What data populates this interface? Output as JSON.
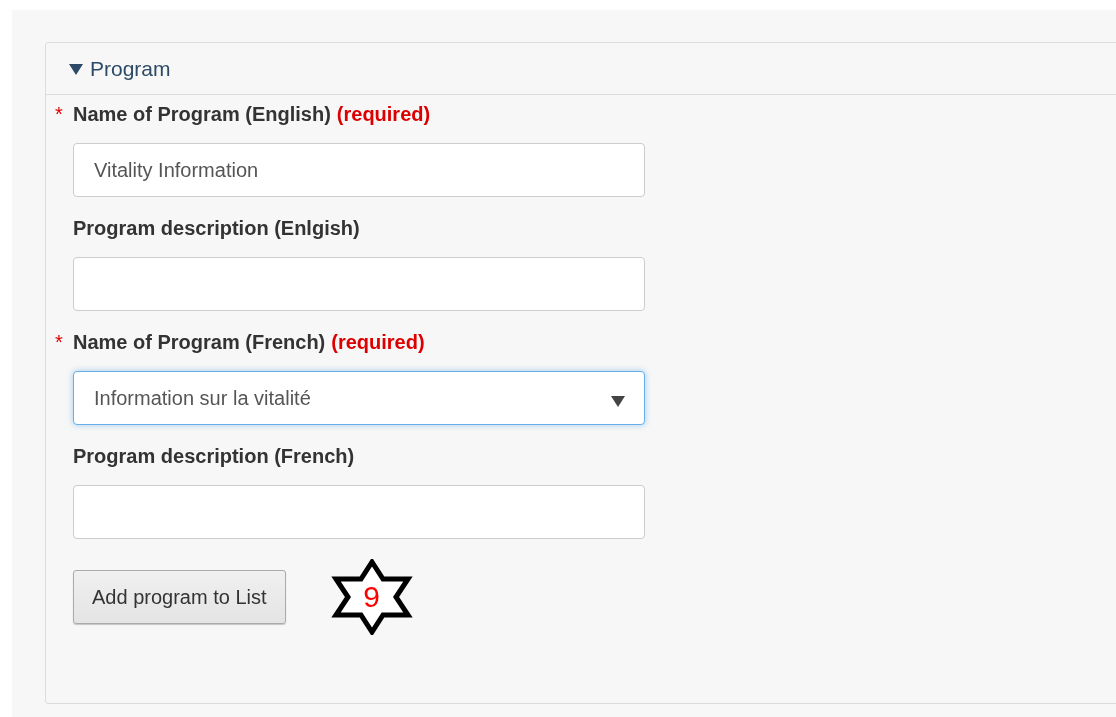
{
  "panel": {
    "title": "Program",
    "expanded": true
  },
  "fields": [
    {
      "kind": "text",
      "label": "Name of Program (English)",
      "required_mark": "*",
      "required_note": "(required)",
      "value": "Vitality Information",
      "focused": false
    },
    {
      "kind": "text",
      "label": "Program description (Enlgish)",
      "focused": false
    },
    {
      "kind": "select",
      "label": "Name of Program (French)",
      "required_mark": "*",
      "required_note": "(required)",
      "value": "Information sur la vitalité",
      "focused": true
    },
    {
      "kind": "text",
      "label": "Program description (French)",
      "focused": false
    }
  ],
  "button": {
    "label": "Add program to List"
  },
  "marker": {
    "number": "9"
  }
}
